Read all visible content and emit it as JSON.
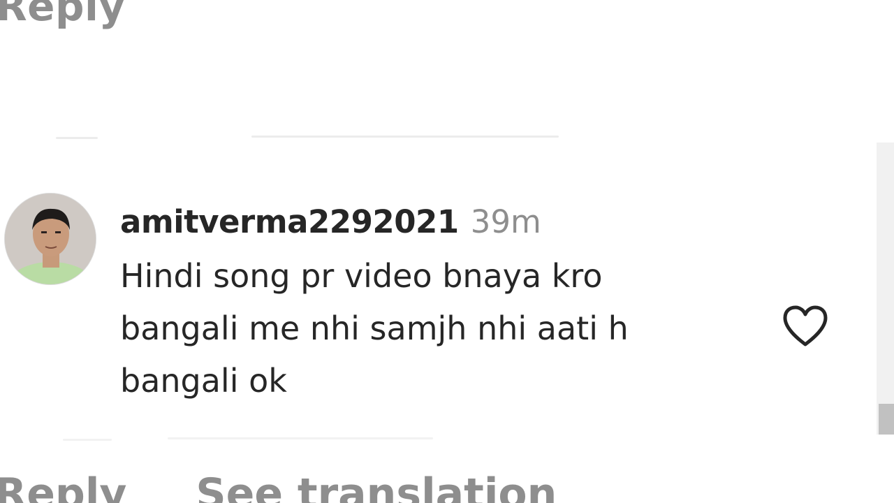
{
  "top_action": {
    "reply_label": "Reply"
  },
  "comment": {
    "username": "amitverma2292021",
    "timestamp": "39m",
    "text_lines": [
      "Hindi song pr video bnaya kro",
      "bangali me nhi samjh nhi aati h",
      "bangali ok"
    ],
    "like_icon": "heart-outline-icon"
  },
  "bottom_actions": {
    "reply_label": "Reply",
    "translation_label": "See translation"
  },
  "colors": {
    "primary_text": "#262626",
    "secondary_text": "#8e8e8e",
    "background": "#ffffff"
  }
}
